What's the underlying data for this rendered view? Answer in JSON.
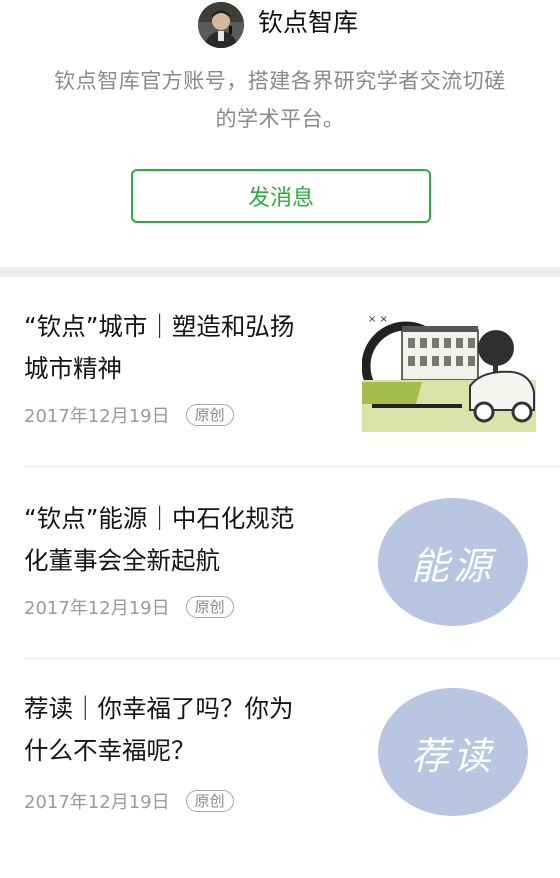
{
  "account": {
    "name": "钦点智库",
    "description_line1": "钦点智库官方账号，搭建各界研究学者交流切磋",
    "description_line2": "的学术平台。",
    "send_button": "发消息"
  },
  "articles": [
    {
      "title_line1": "“钦点”城市｜塑造和弘扬",
      "title_line2": "城市精神",
      "date": "2017年12月19日",
      "badge": "原创"
    },
    {
      "title_line1": "“钦点”能源｜中石化规范",
      "title_line2": "化董事会全新起航",
      "date": "2017年12月19日",
      "badge": "原创",
      "thumb_text": "能源"
    },
    {
      "title_line1": "荐读｜你幸福了吗？你为",
      "title_line2": "什么不幸福呢？",
      "date": "2017年12月19日",
      "badge": "原创",
      "thumb_text": "荐读"
    }
  ],
  "colors": {
    "accent": "#2aae3f",
    "thumb_circle": "#b8c6e2"
  }
}
